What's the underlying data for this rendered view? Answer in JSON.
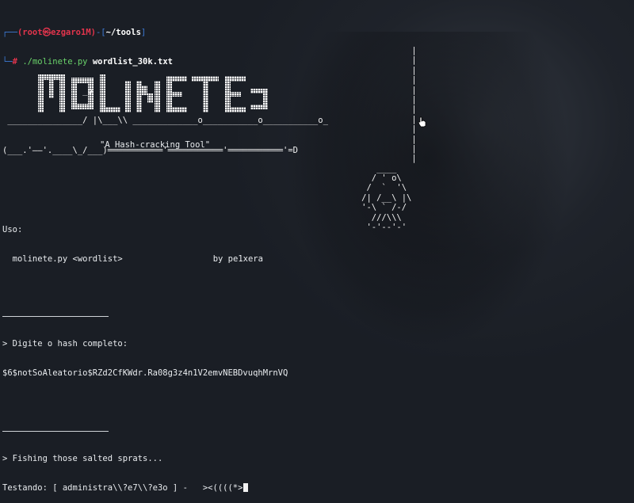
{
  "prompt": {
    "user": "(root㉿ezgaro1M)",
    "cwd": "~/tools",
    "symbol": "#",
    "command": "./molinete.py",
    "argument": "wordlist_30k.txt"
  },
  "ascii_top": {
    "l1": "                _p",
    "l2": " _______________/ |\\___\\\\ _____________o___________o___________o_",
    "l3": "(___.'——'.____\\_/___)═══════════'═══════════'═══════════'=D"
  },
  "banner": {
    "logo_text": "MOLINETE",
    "tagline": "\"A Hash-cracking Tool\""
  },
  "pendant": {
    "lines": [
      "                          |",
      "                          |",
      "                          |",
      "                          |",
      "                          |",
      "                          |",
      "                          |",
      "                          |",
      "                          |",
      "                          |",
      "                          |",
      "                          |",
      "                   ____  ",
      "                  / ' o\\",
      "                 /  `  '\\",
      "                /| /__\\ |\\",
      "                '-\\ ` /-/",
      "                  ///\\\\\\",
      "                 '-'--'-'"
    ]
  },
  "usage": {
    "label": "Uso:",
    "line": "  molinete.py <wordlist>",
    "author": "by pe1xera"
  },
  "hash": {
    "prompt": "> Digite o hash completo:",
    "value": "$6$notSoAleatorio$RZd2CfKWdr.Ra08g3z4n1V2emvNEBDvuqhMrnVQ"
  },
  "status": {
    "fishing": "> Fishing those salted sprats...",
    "testing": "Testando: [ administra\\\\?e7\\\\?e3o ] -   ><((((*>"
  },
  "colors": {
    "background": "#1a1e25",
    "prompt_blue": "#3d7bd8",
    "prompt_red": "#e2344c",
    "command_green": "#6ad36a"
  }
}
